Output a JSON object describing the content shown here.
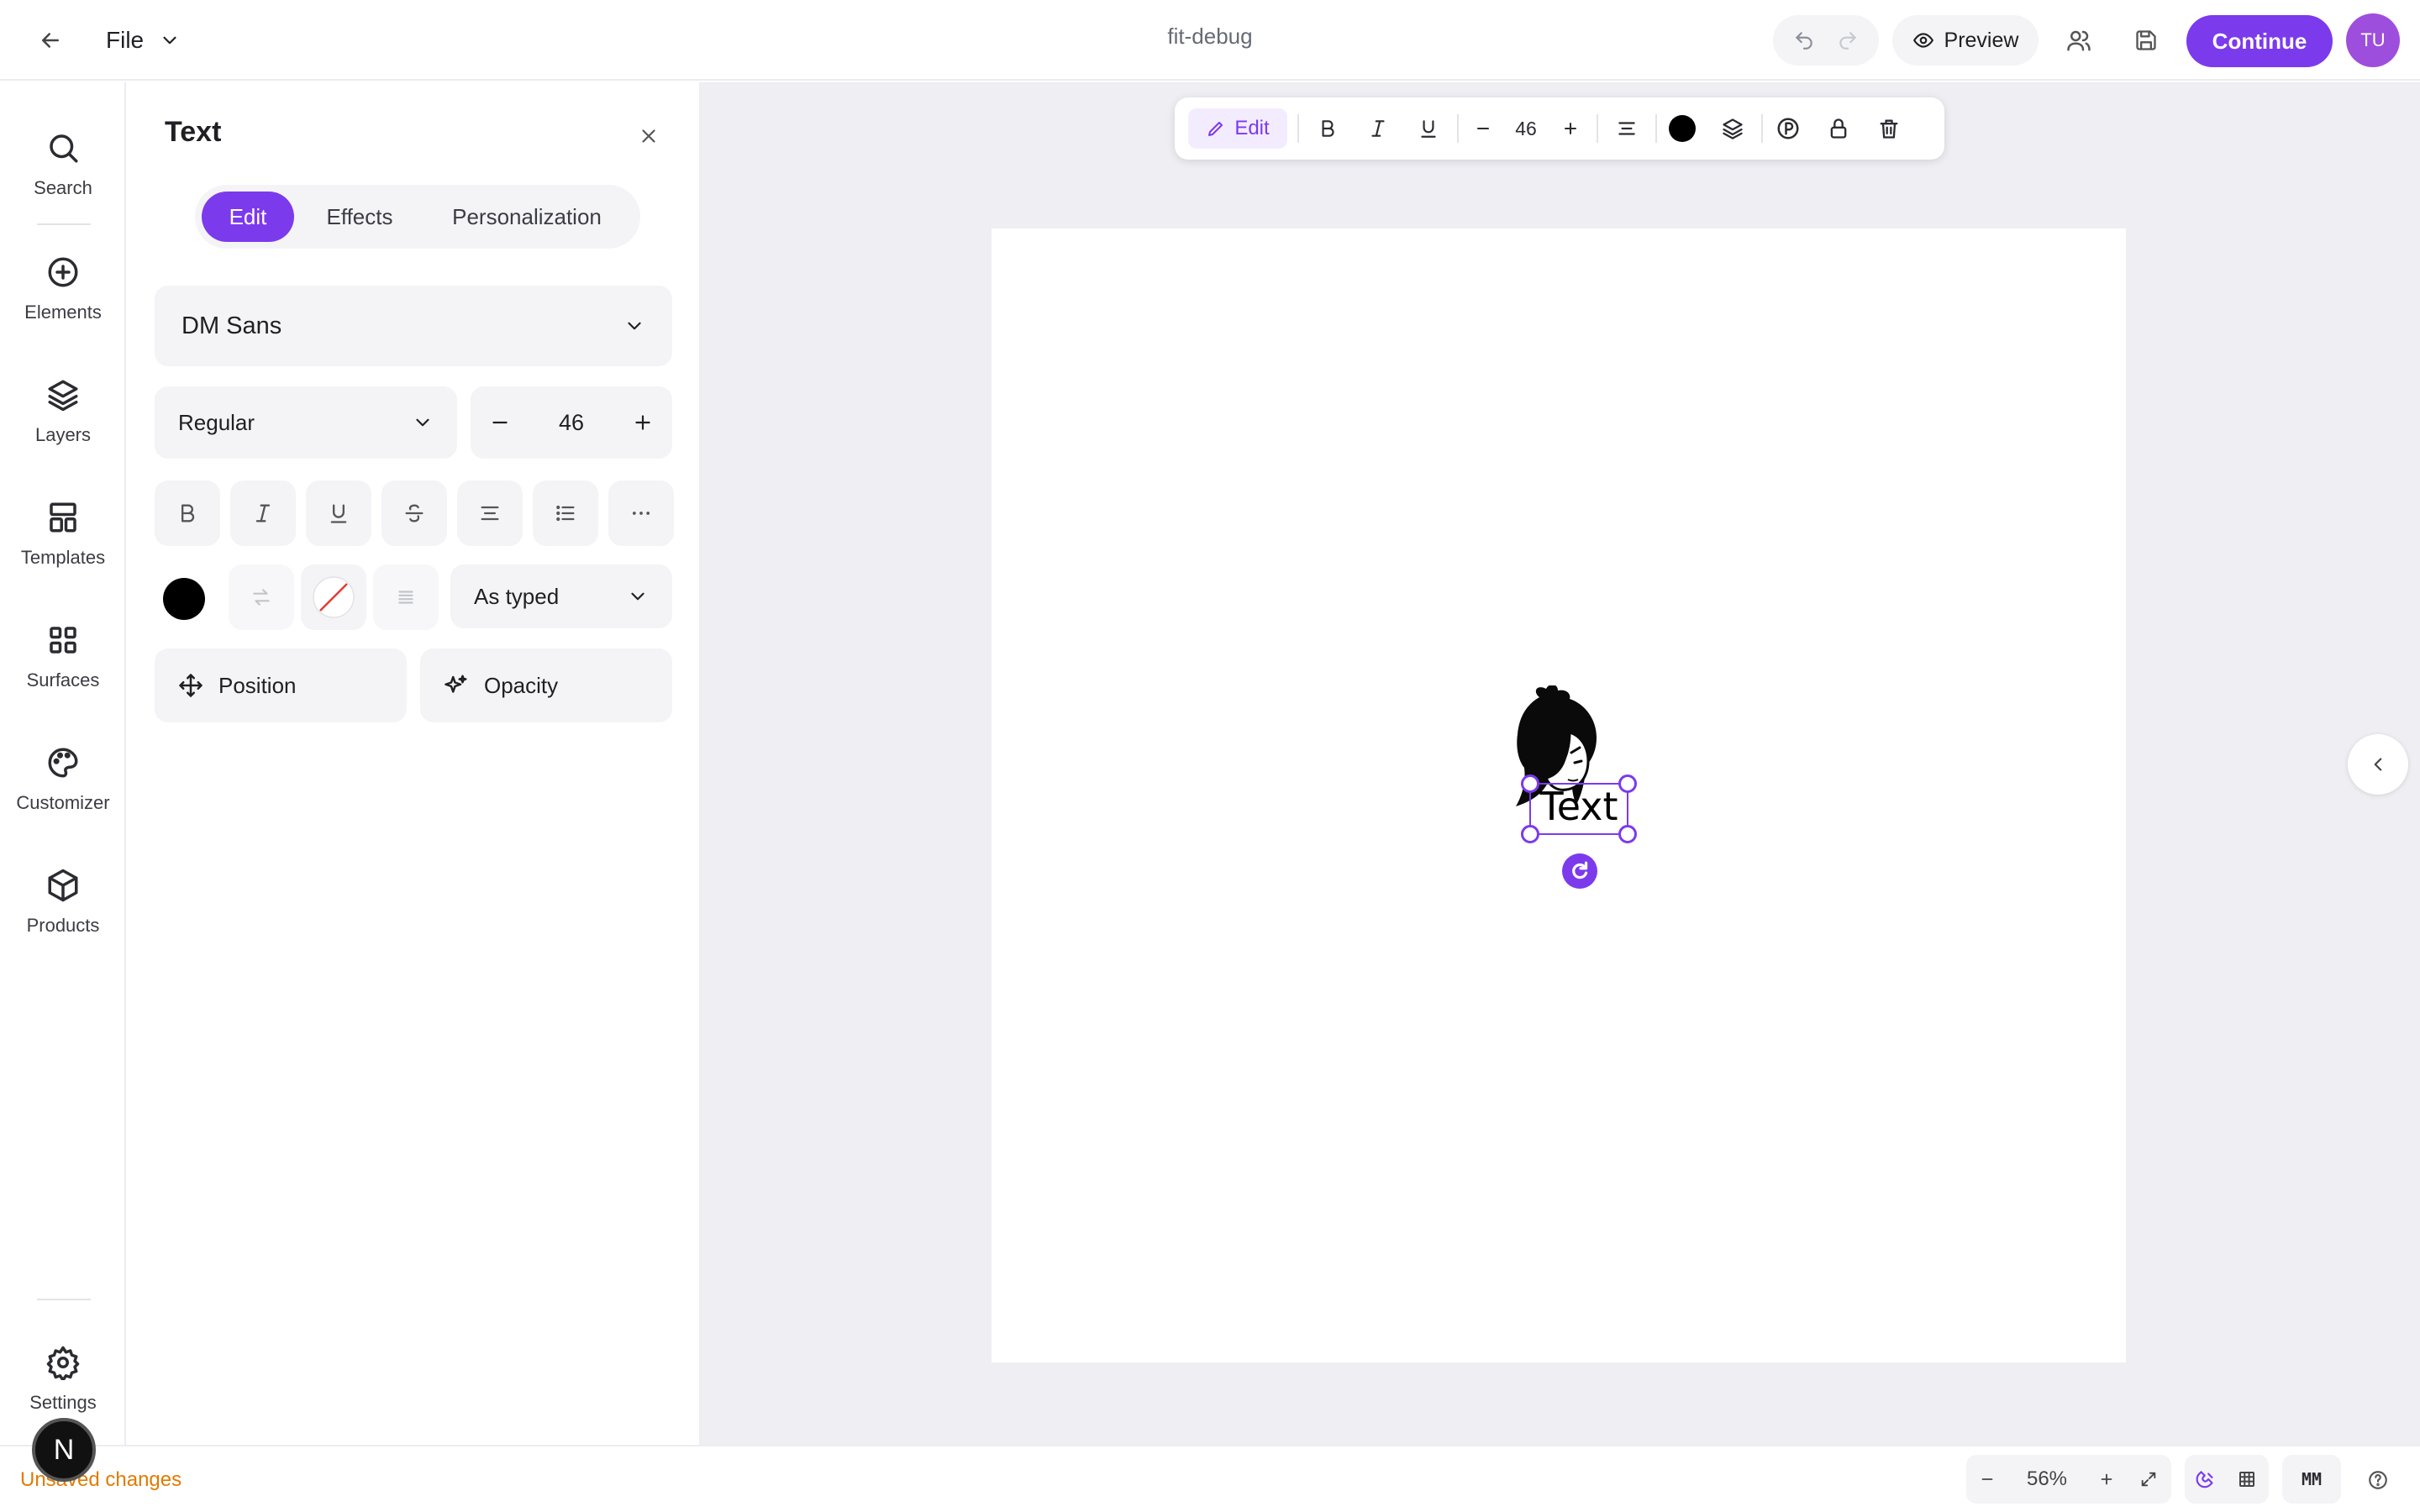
{
  "topbar": {
    "file_label": "File",
    "doc_title": "fit-debug",
    "preview_label": "Preview",
    "continue_label": "Continue",
    "avatar_initials": "TU"
  },
  "rail": {
    "items": [
      {
        "label": "Search",
        "icon": "search-icon"
      },
      {
        "label": "Elements",
        "icon": "plus-circle-icon"
      },
      {
        "label": "Layers",
        "icon": "layers-icon"
      },
      {
        "label": "Templates",
        "icon": "templates-icon"
      },
      {
        "label": "Surfaces",
        "icon": "grid-icon"
      },
      {
        "label": "Customizer",
        "icon": "palette-icon"
      },
      {
        "label": "Products",
        "icon": "box-icon"
      }
    ],
    "settings_label": "Settings"
  },
  "panel": {
    "title": "Text",
    "tabs": [
      {
        "label": "Edit",
        "active": true
      },
      {
        "label": "Effects",
        "active": false
      },
      {
        "label": "Personalization",
        "active": false
      }
    ],
    "font_family": "DM Sans",
    "font_weight": "Regular",
    "font_size": "46",
    "text_color": "#000000",
    "case_mode": "As typed",
    "position_label": "Position",
    "opacity_label": "Opacity"
  },
  "toolbar": {
    "edit_label": "Edit",
    "font_size": "46",
    "color": "#000000"
  },
  "canvas": {
    "text_content": "Text",
    "accent": "#7c3aed"
  },
  "bottombar": {
    "status": "Unsaved changes",
    "zoom": "56%",
    "unit": "MM",
    "badge": "N"
  }
}
